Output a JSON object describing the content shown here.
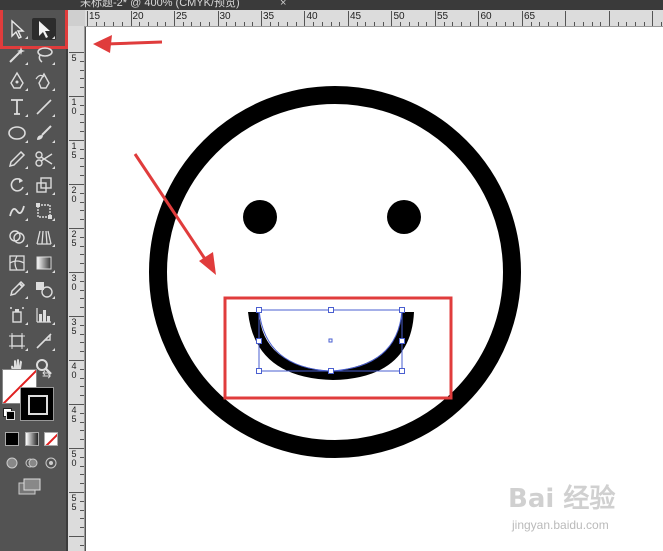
{
  "window": {
    "tab_title": "未标题-2* @ 400% (CMYK/预览)",
    "tab_close": "×"
  },
  "rulers": {
    "horizontal": [
      "15",
      "20",
      "25",
      "30",
      "35",
      "40",
      "45",
      "50",
      "55",
      "60",
      "65"
    ],
    "vertical": [
      "5",
      "1 0",
      "1 5",
      "2 0",
      "2 5",
      "3 0",
      "3 5",
      "4 0",
      "4 5",
      "5 0",
      "5 5"
    ]
  },
  "toolbar": {
    "tools": [
      {
        "name": "selection-tool-icon",
        "active": false
      },
      {
        "name": "direct-selection-tool-icon",
        "active": true
      },
      {
        "name": "magic-wand-tool-icon",
        "active": false
      },
      {
        "name": "lasso-tool-icon",
        "active": false
      },
      {
        "name": "pen-tool-icon",
        "active": false
      },
      {
        "name": "curvature-tool-icon",
        "active": false
      },
      {
        "name": "type-tool-icon",
        "active": false
      },
      {
        "name": "line-segment-tool-icon",
        "active": false
      },
      {
        "name": "ellipse-tool-icon",
        "active": false
      },
      {
        "name": "paintbrush-tool-icon",
        "active": false
      },
      {
        "name": "pencil-tool-icon",
        "active": false
      },
      {
        "name": "scissors-tool-icon",
        "active": false
      },
      {
        "name": "rotate-tool-icon",
        "active": false
      },
      {
        "name": "scale-tool-icon",
        "active": false
      },
      {
        "name": "warp-tool-icon",
        "active": false
      },
      {
        "name": "free-transform-tool-icon",
        "active": false
      },
      {
        "name": "shape-builder-tool-icon",
        "active": false
      },
      {
        "name": "perspective-grid-tool-icon",
        "active": false
      },
      {
        "name": "mesh-tool-icon",
        "active": false
      },
      {
        "name": "gradient-tool-icon",
        "active": false
      },
      {
        "name": "eyedropper-tool-icon",
        "active": false
      },
      {
        "name": "blend-tool-icon",
        "active": false
      },
      {
        "name": "symbol-sprayer-tool-icon",
        "active": false
      },
      {
        "name": "column-graph-tool-icon",
        "active": false
      },
      {
        "name": "artboard-tool-icon",
        "active": false
      },
      {
        "name": "slice-tool-icon",
        "active": false
      },
      {
        "name": "hand-tool-icon",
        "active": false
      },
      {
        "name": "zoom-tool-icon",
        "active": false
      }
    ],
    "fill_color": "none",
    "stroke_color": "#000000"
  },
  "annotations": {
    "highlight_color": "#e03c3c"
  },
  "canvas": {
    "background": "#ffffff",
    "face_color": "#000000",
    "selection_color": "#4a5fd0"
  },
  "watermark": {
    "logo_text": "Bai 经验",
    "url": "jingyan.baidu.com"
  }
}
